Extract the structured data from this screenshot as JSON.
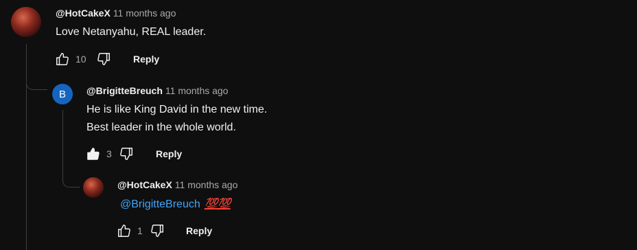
{
  "comments": [
    {
      "author": "@HotCakeX",
      "time": "11 months ago",
      "text_lines": [
        "Love Netanyahu, REAL leader."
      ],
      "likes": "10",
      "liked": false,
      "reply_label": "Reply",
      "avatar": "red-anime-avatar"
    },
    {
      "author": "@BrigitteBreuch",
      "time": "11 months ago",
      "text_lines": [
        "He is like King David in the new time.",
        "Best leader in the whole world."
      ],
      "likes": "3",
      "liked": true,
      "reply_label": "Reply",
      "avatar_letter": "B"
    },
    {
      "author": "@HotCakeX",
      "time": "11 months ago",
      "mention": "@BrigitteBreuch",
      "emoji": "💯💯",
      "likes": "1",
      "liked": false,
      "reply_label": "Reply",
      "avatar": "red-anime-avatar"
    }
  ],
  "colors": {
    "background": "#0f0f0f",
    "mention": "#3ea6ff",
    "avatar_letter_bg": "#1565c0"
  }
}
